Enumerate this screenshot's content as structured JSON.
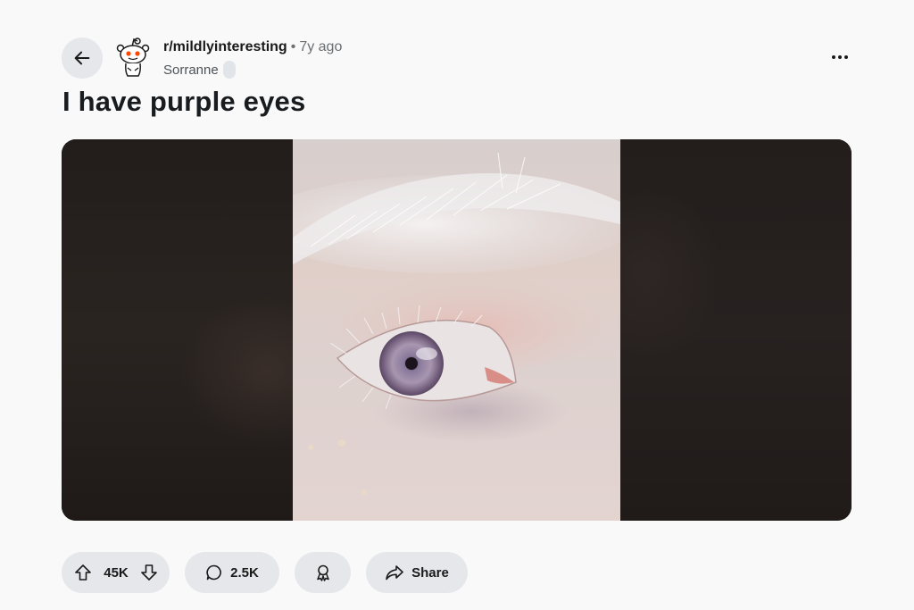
{
  "post": {
    "subreddit": "r/mildlyinteresting",
    "separator": "•",
    "age": "7y ago",
    "author": "Sorranne",
    "title": "I have purple eyes"
  },
  "actions": {
    "score": "45K",
    "comments": "2.5K",
    "share_label": "Share"
  },
  "icons": {
    "back": "arrow-left-icon",
    "avatar": "reddit-snoo-icon",
    "overflow": "more-horizontal-icon",
    "upvote": "arrow-up-icon",
    "downvote": "arrow-down-icon",
    "comment": "comment-bubble-icon",
    "award": "award-icon",
    "share": "share-arrow-icon"
  },
  "colors": {
    "background": "#f9f9fa",
    "pill": "#e5e7ea",
    "text": "#1a1a1b",
    "muted": "#6b6f72",
    "reddit_orange": "#ff4500"
  }
}
